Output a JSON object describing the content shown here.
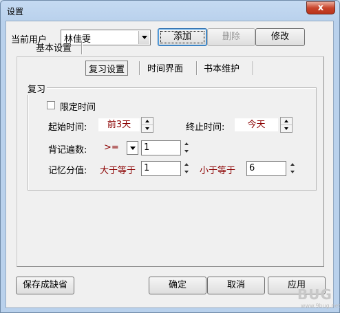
{
  "window": {
    "title": "设置",
    "close_glyph": "x"
  },
  "user": {
    "label": "当前用户",
    "selected": "林佳雯",
    "add": "添加",
    "delete": "删除",
    "edit": "修改"
  },
  "tabs": [
    {
      "label": "基本设置",
      "active": false
    },
    {
      "label": "复习设置",
      "active": true
    },
    {
      "label": "时间界面",
      "active": false
    },
    {
      "label": "书本维护",
      "active": false
    }
  ],
  "review": {
    "group_title": "复习",
    "limit_time_label": "限定时间",
    "limit_time_checked": false,
    "start_label": "起始时间:",
    "start_value": "前3天",
    "end_label": "终止时间:",
    "end_value": "今天",
    "count_label": "背记遍数:",
    "count_operator": ">=",
    "count_value": "1",
    "score_label": "记忆分值:",
    "gte_label": "大于等于",
    "score_min": "1",
    "lt_label": "小于等于",
    "score_max": "6"
  },
  "footer": {
    "save_default": "保存成缺省",
    "ok": "确定",
    "cancel": "取消",
    "apply": "应用"
  },
  "watermark": {
    "brand": "BUG",
    "sub": "www.9bug.net"
  }
}
